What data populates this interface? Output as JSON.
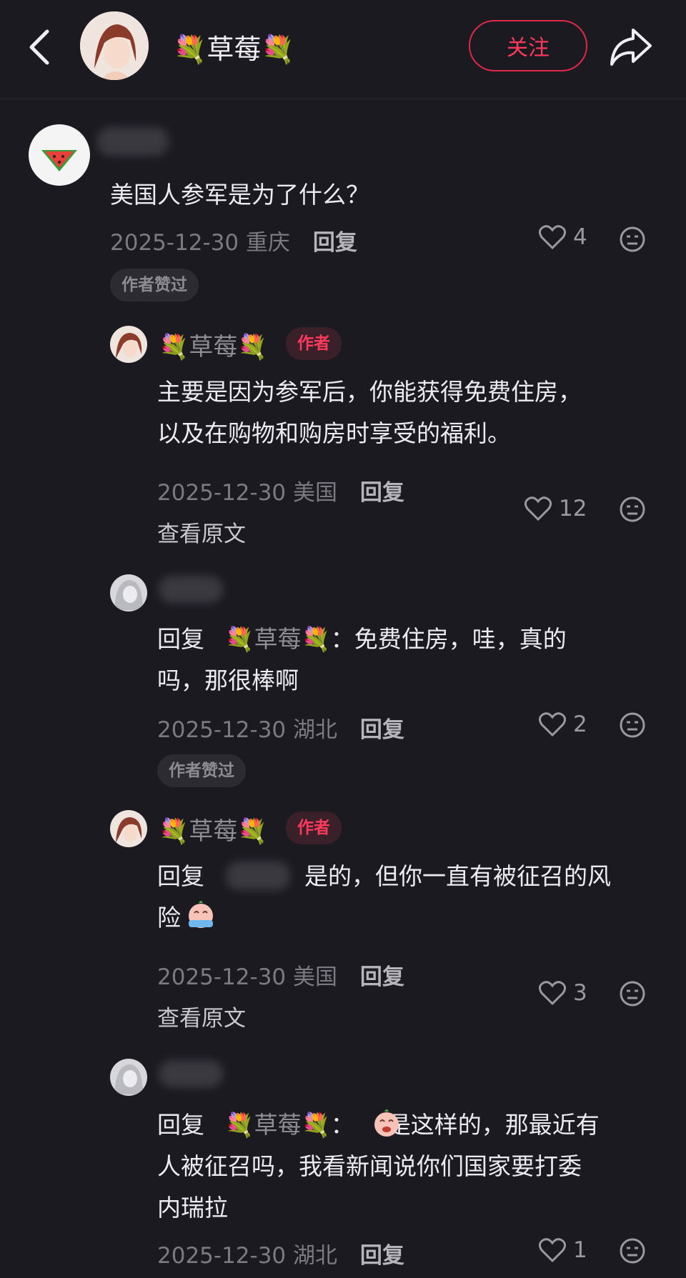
{
  "header": {
    "title": "💐草莓💐",
    "follow_label": "关注"
  },
  "comments": [
    {
      "text": "美国人参军是为了什么？",
      "date": "2025-12-30",
      "location": "重庆",
      "reply_label": "回复",
      "likes": "4",
      "badge": "作者赞过"
    },
    {
      "name": "💐草莓💐",
      "tag": "作者",
      "text_line1": "主要是因为参军后，你能获得免费住房，",
      "text_line2": "以及在购物和购房时享受的福利。",
      "date": "2025-12-30",
      "location": "美国",
      "reply_label": "回复",
      "likes": "12",
      "view_original": "查看原文"
    },
    {
      "reply_prefix": "回复",
      "reply_to": "💐草莓💐",
      "text_line1": "：免费住房，哇，真的",
      "text_line2": "吗，那很棒啊",
      "date": "2025-12-30",
      "location": "湖北",
      "reply_label": "回复",
      "likes": "2",
      "badge": "作者赞过"
    },
    {
      "name": "💐草莓💐",
      "tag": "作者",
      "reply_prefix": "回复",
      "text_line1": "是的，但你一直有被征召的风",
      "text_line2": "险",
      "date": "2025-12-30",
      "location": "美国",
      "reply_label": "回复",
      "likes": "3",
      "view_original": "查看原文"
    },
    {
      "reply_prefix": "回复",
      "reply_to": "💐草莓💐",
      "text_line1": "：",
      "text_line1b": "是这样的，那最近有",
      "text_line2": "人被征召吗，我看新闻说你们国家要打委",
      "text_line3": "内瑞拉",
      "date": "2025-12-30",
      "location": "湖北",
      "reply_label": "回复",
      "likes": "1"
    }
  ],
  "colors": {
    "accent": "#ff3a5c",
    "background": "#1b1a21"
  }
}
